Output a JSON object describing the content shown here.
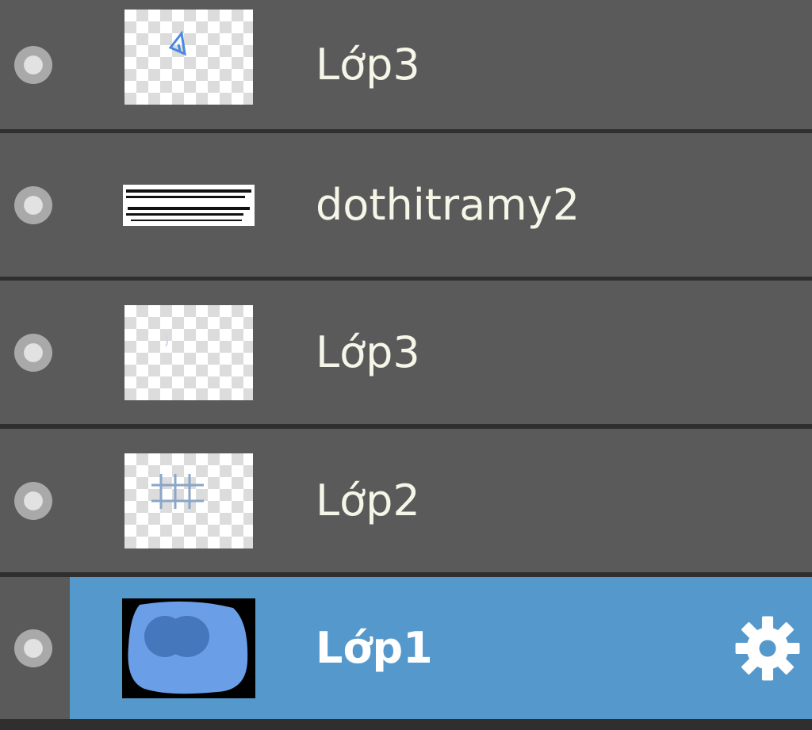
{
  "layers": [
    {
      "name": "Lớp3",
      "visible_icon": "visibility-dot-icon",
      "thumbnail": "transparent-sketch"
    },
    {
      "name": "dothitramy2",
      "visible_icon": "visibility-dot-icon",
      "thumbnail": "text-strip"
    },
    {
      "name": "Lớp3",
      "visible_icon": "visibility-dot-icon",
      "thumbnail": "transparent-empty"
    },
    {
      "name": "Lớp2",
      "visible_icon": "visibility-dot-icon",
      "thumbnail": "transparent-grid-sketch"
    },
    {
      "name": "Lớp1",
      "visible_icon": "visibility-dot-icon",
      "thumbnail": "blue-shape",
      "selected": true,
      "settings_icon": "gear-icon"
    }
  ],
  "colors": {
    "row_background": "#5a5a5a",
    "row_separator": "#2f2f2f",
    "selected_background": "#5599cc",
    "text": "#f5f5e8"
  }
}
